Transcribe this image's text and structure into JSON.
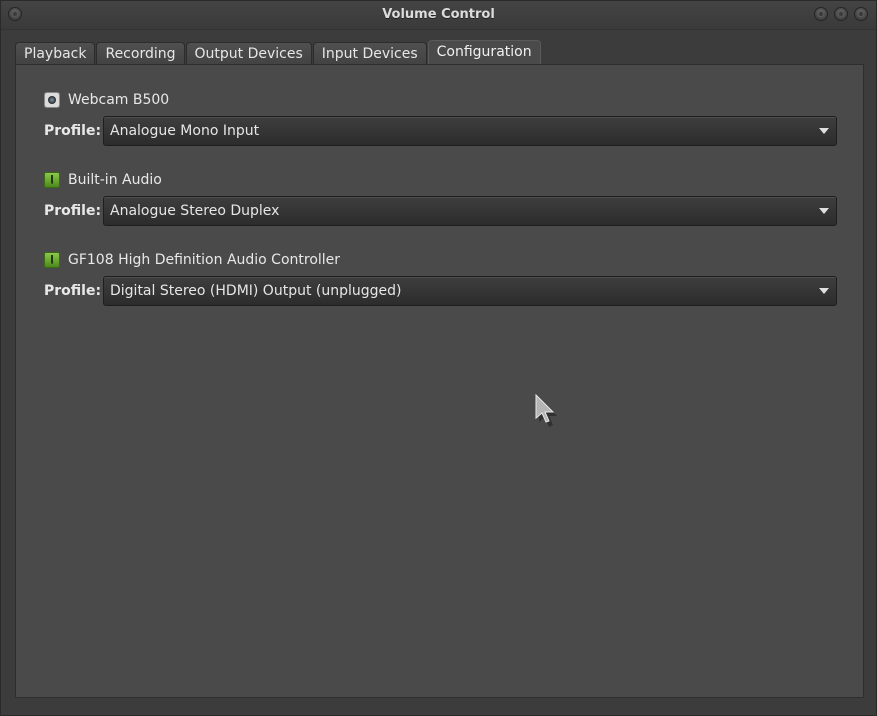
{
  "window": {
    "title": "Volume Control"
  },
  "tabs": [
    {
      "label": "Playback",
      "active": false
    },
    {
      "label": "Recording",
      "active": false
    },
    {
      "label": "Output Devices",
      "active": false
    },
    {
      "label": "Input Devices",
      "active": false
    },
    {
      "label": "Configuration",
      "active": true
    }
  ],
  "devices": [
    {
      "name": "Webcam B500",
      "icon": "webcam-icon",
      "profile_label": "Profile:",
      "profile_value": "Analogue Mono Input"
    },
    {
      "name": "Built-in Audio",
      "icon": "audio-card-icon",
      "profile_label": "Profile:",
      "profile_value": "Analogue Stereo Duplex"
    },
    {
      "name": "GF108 High Definition Audio Controller",
      "icon": "audio-card-icon",
      "profile_label": "Profile:",
      "profile_value": "Digital Stereo (HDMI) Output (unplugged)"
    }
  ],
  "colors": {
    "background": "#4a4a4a",
    "text": "#e8e8e8",
    "audio_icon_green": "#6aa832"
  }
}
